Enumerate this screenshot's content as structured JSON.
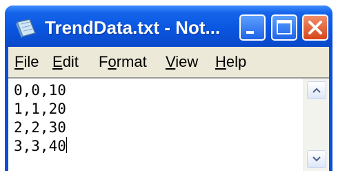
{
  "window": {
    "title": "TrendData.txt - Not...",
    "buttons": {
      "minimize": "minimize-icon",
      "maximize": "maximize-icon",
      "close": "close-icon"
    }
  },
  "menu": {
    "file": {
      "accel": "F",
      "rest": "ile"
    },
    "edit": {
      "accel": "E",
      "rest": "dit"
    },
    "format": {
      "pre": "F",
      "accel": "o",
      "rest": "rmat"
    },
    "view": {
      "accel": "V",
      "rest": "iew"
    },
    "help": {
      "accel": "H",
      "rest": "elp"
    }
  },
  "editor": {
    "lines": [
      "0,0,10",
      "1,1,20",
      "2,2,30",
      "3,3,40"
    ]
  },
  "colors": {
    "titlebar": "#0a56e0",
    "close_button": "#d6461a",
    "menubar": "#ece9d8"
  },
  "icons": [
    "notepad-icon",
    "scroll-up-arrow-icon",
    "scroll-down-arrow-icon"
  ]
}
